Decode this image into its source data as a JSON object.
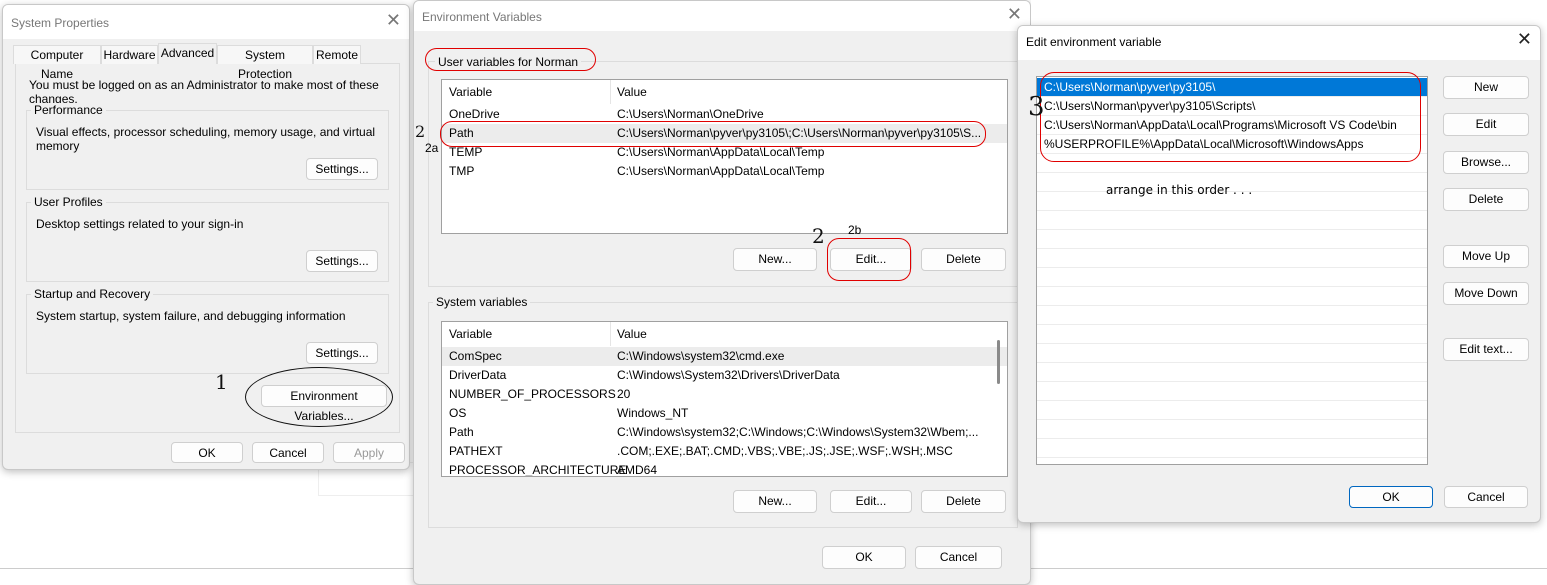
{
  "system_properties": {
    "title": "System Properties",
    "tabs": [
      "Computer Name",
      "Hardware",
      "Advanced",
      "System Protection",
      "Remote"
    ],
    "active_tab": "Advanced",
    "admin_note": "You must be logged on as an Administrator to make most of these changes.",
    "groups": [
      {
        "label": "Performance",
        "desc": "Visual effects, processor scheduling, memory usage, and virtual memory",
        "button": "Settings..."
      },
      {
        "label": "User Profiles",
        "desc": "Desktop settings related to your sign-in",
        "button": "Settings..."
      },
      {
        "label": "Startup and Recovery",
        "desc": "System startup, system failure, and debugging information",
        "button": "Settings..."
      }
    ],
    "env_button": "Environment Variables...",
    "ok": "OK",
    "cancel": "Cancel",
    "apply": "Apply"
  },
  "env_vars": {
    "title": "Environment Variables",
    "user_group": "User variables for Norman",
    "col_variable": "Variable",
    "col_value": "Value",
    "user_rows": [
      {
        "var": "OneDrive",
        "val": "C:\\Users\\Norman\\OneDrive"
      },
      {
        "var": "Path",
        "val": "C:\\Users\\Norman\\pyver\\py3105\\;C:\\Users\\Norman\\pyver\\py3105\\S..."
      },
      {
        "var": "TEMP",
        "val": "C:\\Users\\Norman\\AppData\\Local\\Temp"
      },
      {
        "var": "TMP",
        "val": "C:\\Users\\Norman\\AppData\\Local\\Temp"
      }
    ],
    "system_group": "System variables",
    "system_rows": [
      {
        "var": "ComSpec",
        "val": "C:\\Windows\\system32\\cmd.exe"
      },
      {
        "var": "DriverData",
        "val": "C:\\Windows\\System32\\Drivers\\DriverData"
      },
      {
        "var": "NUMBER_OF_PROCESSORS",
        "val": "20"
      },
      {
        "var": "OS",
        "val": "Windows_NT"
      },
      {
        "var": "Path",
        "val": "C:\\Windows\\system32;C:\\Windows;C:\\Windows\\System32\\Wbem;..."
      },
      {
        "var": "PATHEXT",
        "val": ".COM;.EXE;.BAT;.CMD;.VBS;.VBE;.JS;.JSE;.WSF;.WSH;.MSC"
      },
      {
        "var": "PROCESSOR_ARCHITECTURE",
        "val": "AMD64"
      }
    ],
    "new": "New...",
    "edit": "Edit...",
    "delete": "Delete",
    "ok": "OK",
    "cancel": "Cancel"
  },
  "edit_env": {
    "title": "Edit environment variable",
    "entries": [
      "C:\\Users\\Norman\\pyver\\py3105\\",
      "C:\\Users\\Norman\\pyver\\py3105\\Scripts\\",
      "C:\\Users\\Norman\\AppData\\Local\\Programs\\Microsoft VS Code\\bin",
      "%USERPROFILE%\\AppData\\Local\\Microsoft\\WindowsApps"
    ],
    "buttons": [
      "New",
      "Edit",
      "Browse...",
      "Delete",
      "Move Up",
      "Move Down",
      "Edit text..."
    ],
    "ok": "OK",
    "cancel": "Cancel"
  },
  "annotations": {
    "step1": "1",
    "step2": "2",
    "step2a": "2a",
    "step2b": "2b",
    "step3": "3",
    "note": "arrange in this order . . ."
  },
  "colors": {
    "selection": "#0078d7",
    "annotation": "#e00000",
    "dialog_bg": "#f0f0f0"
  }
}
